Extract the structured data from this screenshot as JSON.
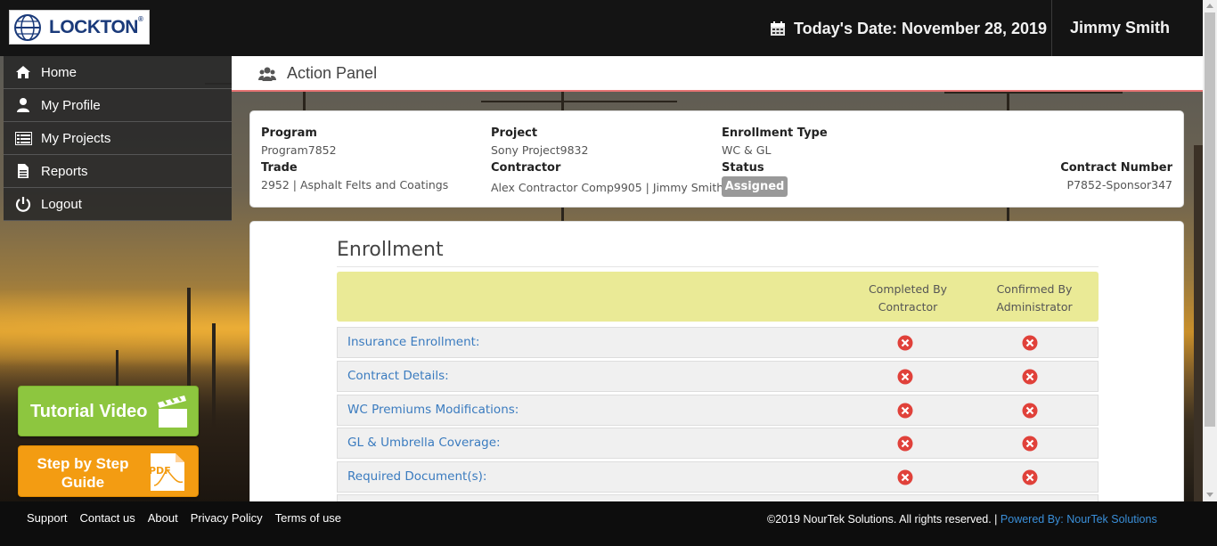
{
  "header": {
    "logo_text": "LOCKTON",
    "logo_mark": "®",
    "date_label": "Today's Date: November 28, 2019",
    "user_name": "Jimmy Smith"
  },
  "sidebar": {
    "items": [
      {
        "label": "Home",
        "icon": "home-icon"
      },
      {
        "label": "My Profile",
        "icon": "user-icon"
      },
      {
        "label": "My Projects",
        "icon": "list-icon"
      },
      {
        "label": "Reports",
        "icon": "document-icon"
      },
      {
        "label": "Logout",
        "icon": "power-icon"
      }
    ]
  },
  "promos": {
    "video_label": "Tutorial Video",
    "guide_label": "Step by Step Guide",
    "pdf_text": "PDF"
  },
  "action_panel": {
    "title": "Action Panel"
  },
  "info": {
    "program_label": "Program",
    "program_value": "Program7852",
    "trade_label": "Trade",
    "trade_value": "2952 | Asphalt Felts and Coatings",
    "project_label": "Project",
    "project_value": "Sony Project9832",
    "contractor_label": "Contractor",
    "contractor_value": "Alex Contractor Comp9905 | Jimmy Smith",
    "enrollment_type_label": "Enrollment Type",
    "enrollment_type_value": "WC & GL",
    "status_label": "Status",
    "status_value": "Assigned",
    "contract_number_label": "Contract Number",
    "contract_number_value": "P7852-Sponsor347"
  },
  "enrollment": {
    "title": "Enrollment",
    "col_contractor_line1": "Completed By",
    "col_contractor_line2": "Contractor",
    "col_admin_line1": "Confirmed By",
    "col_admin_line2": "Administrator",
    "rows": [
      {
        "label": "Insurance Enrollment:",
        "contractor": "incomplete",
        "admin": "incomplete"
      },
      {
        "label": "Contract Details:",
        "contractor": "incomplete",
        "admin": "incomplete"
      },
      {
        "label": "WC Premiums Modifications:",
        "contractor": "incomplete",
        "admin": "incomplete"
      },
      {
        "label": "GL & Umbrella Coverage:",
        "contractor": "incomplete",
        "admin": "incomplete"
      },
      {
        "label": "Required Document(s):",
        "contractor": "incomplete",
        "admin": "incomplete"
      }
    ]
  },
  "footer": {
    "links": [
      "Support",
      "Contact us",
      "About",
      "Privacy Policy",
      "Terms of use"
    ],
    "copyright": "©2019 NourTek Solutions. All rights reserved. |",
    "powered_by": "Powered By: NourTek Solutions"
  },
  "colors": {
    "status_incomplete": "#e0413a",
    "accent_link": "#3a7bbf",
    "header_bg": "#eaea96"
  }
}
